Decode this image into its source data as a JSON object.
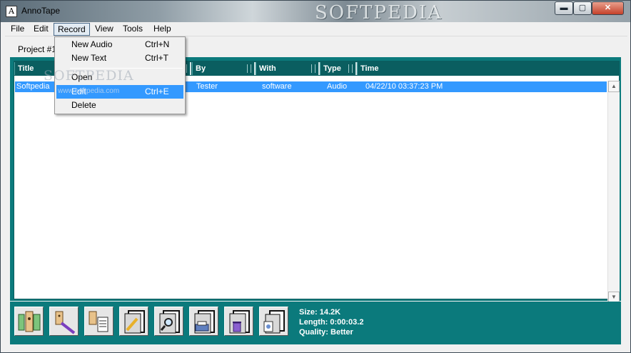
{
  "window": {
    "title": "AnnoTape",
    "app_icon_glyph": "A",
    "banner_text": "SOFTPEDIA",
    "controls": {
      "minimize": "▬",
      "maximize": "▢",
      "close": "✕"
    }
  },
  "menubar": {
    "items": [
      "File",
      "Edit",
      "Record",
      "View",
      "Tools",
      "Help"
    ],
    "active": "Record"
  },
  "tab": {
    "label": "Project #1"
  },
  "record_menu": {
    "items": [
      {
        "label": "New Audio",
        "shortcut": "Ctrl+N"
      },
      {
        "label": "New Text",
        "shortcut": "Ctrl+T"
      },
      {
        "label": "Open",
        "shortcut": ""
      },
      {
        "label": "Edit",
        "shortcut": "Ctrl+E",
        "highlighted": true
      },
      {
        "label": "Delete",
        "shortcut": ""
      }
    ]
  },
  "list": {
    "columns": [
      "Title",
      "By",
      "With",
      "Type",
      "Time"
    ],
    "rows": [
      {
        "title": "Softpedia",
        "by": "Tester",
        "with": "software",
        "type": "Audio",
        "time": "04/22/10 03:37:23 PM",
        "selected": true
      }
    ]
  },
  "toolbar": {
    "buttons": [
      "play-recording-icon",
      "annotate-pen-icon",
      "text-note-icon",
      "edit-pencil-icon",
      "search-magnifier-icon",
      "print-icon",
      "delete-trash-icon",
      "properties-icon"
    ]
  },
  "status": {
    "size": "Size: 14.2K",
    "length": "Length: 0:00:03.2",
    "quality": "Quality: Better"
  },
  "watermark": {
    "logo": "SOFTPEDIA",
    "url": "www.softpedia.com"
  },
  "colors": {
    "panel_teal": "#0b7a7c",
    "header_teal": "#0a5e60",
    "selection": "#3399ff"
  }
}
